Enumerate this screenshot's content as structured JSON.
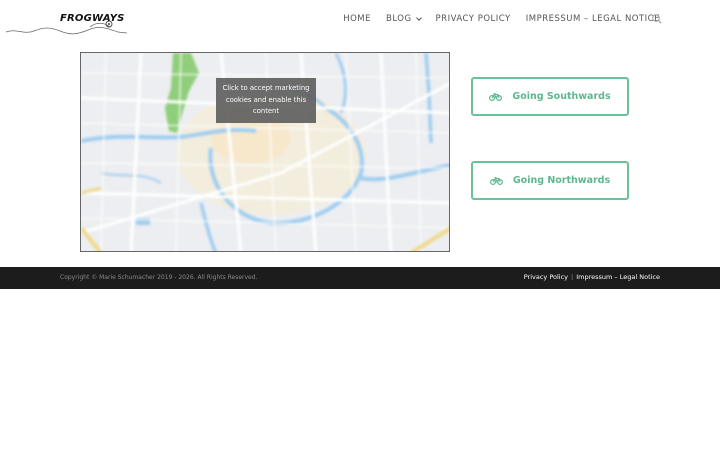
{
  "site": {
    "logo_text": "FROGWAYS"
  },
  "nav": {
    "items": [
      {
        "label": "HOME"
      },
      {
        "label": "BLOG"
      },
      {
        "label": "PRIVACY POLICY"
      },
      {
        "label": "IMPRESSUM – LEGAL NOTICE"
      }
    ],
    "search_icon": "search-icon"
  },
  "map": {
    "consent_text": "Click to accept marketing cookies and enable this content"
  },
  "buttons": {
    "south": {
      "label": "Going Southwards",
      "icon": "bicycle-icon"
    },
    "north": {
      "label": "Going Northwards",
      "icon": "bicycle-icon"
    }
  },
  "footer": {
    "copyright": "Copyright © Marie Schumacher 2019 - 2026. All Rights Reserved.",
    "links": [
      {
        "label": "Privacy Policy"
      },
      {
        "label": "Impressum – Legal Notice"
      }
    ],
    "separator": "|"
  },
  "colors": {
    "accent": "#5cb88f",
    "footer_bg": "#1c1c1c",
    "water": "#9fcdf0",
    "park": "#8fce7a"
  }
}
